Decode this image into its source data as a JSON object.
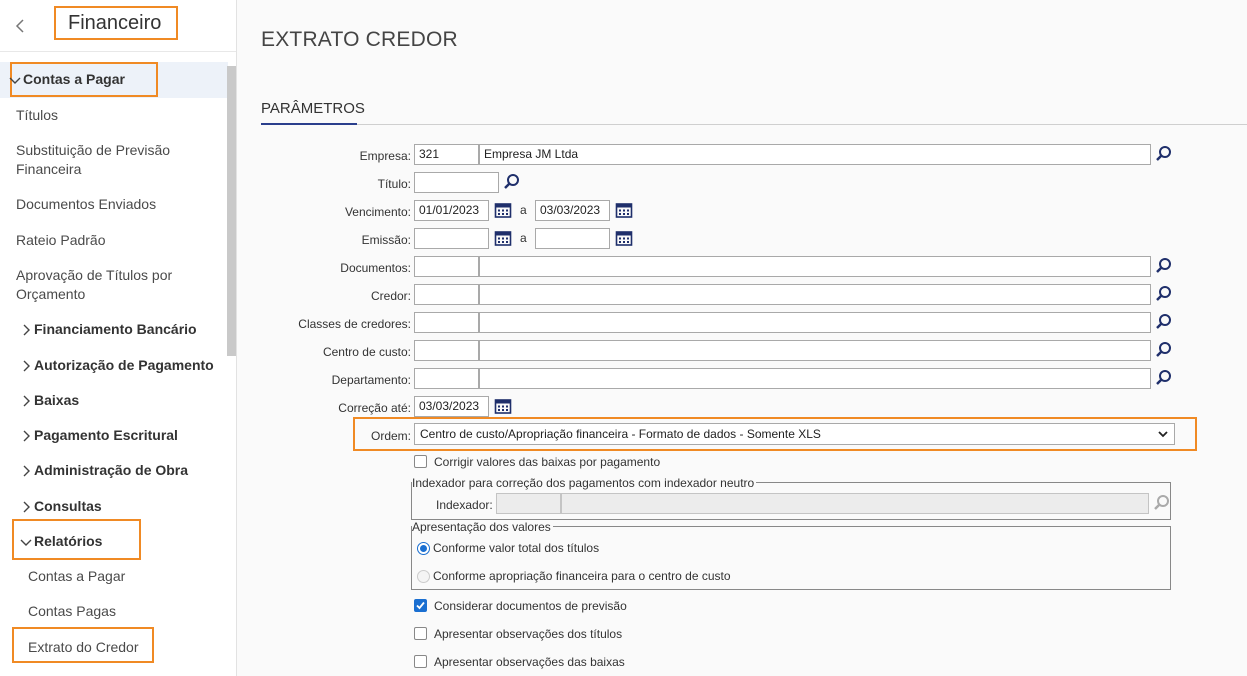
{
  "sidebar": {
    "title": "Financeiro",
    "active_group": "Contas a Pagar",
    "items": [
      "Títulos",
      "Substituição de Previsão Financeira",
      "Documentos Enviados",
      "Rateio Padrão",
      "Aprovação de Títulos por Orçamento"
    ],
    "groups": [
      "Financiamento Bancário",
      "Autorização de Pagamento",
      "Baixas",
      "Pagamento Escritural",
      "Administração de Obra",
      "Consultas"
    ],
    "reports_group": "Relatórios",
    "reports": [
      "Contas a Pagar",
      "Contas Pagas",
      "Extrato do Credor"
    ]
  },
  "page": {
    "title": "EXTRATO CREDOR",
    "section": "PARÂMETROS"
  },
  "form": {
    "empresa_label": "Empresa:",
    "empresa_code": "321",
    "empresa_name": "Empresa JM Ltda",
    "titulo_label": "Título:",
    "vencimento_label": "Vencimento:",
    "vencimento_from": "01/01/2023",
    "vencimento_to": "03/03/2023",
    "range_sep": "a",
    "emissao_label": "Emissão:",
    "documentos_label": "Documentos:",
    "credor_label": "Credor:",
    "classes_label": "Classes de credores:",
    "centro_label": "Centro de custo:",
    "departamento_label": "Departamento:",
    "correcao_label": "Correção até:",
    "correcao_value": "03/03/2023",
    "ordem_label": "Ordem:",
    "ordem_value": "Centro de custo/Apropriação financeira - Formato de dados - Somente XLS",
    "corrigir_label": "Corrigir valores das baixas por pagamento",
    "indexador_legend": "Indexador para correção dos pagamentos com indexador neutro",
    "indexador_label": "Indexador:",
    "apresentacao_legend": "Apresentação dos valores",
    "radio_total": "Conforme valor total dos títulos",
    "radio_apropriacao": "Conforme apropriação financeira para o centro de custo",
    "considerar_label": "Considerar documentos de previsão",
    "obs_titulos_label": "Apresentar observações dos títulos",
    "obs_baixas_label": "Apresentar observações das baixas"
  },
  "colors": {
    "highlight": "#f08a24",
    "accent": "#2a3e8c",
    "checkbox": "#1a6fd1"
  }
}
